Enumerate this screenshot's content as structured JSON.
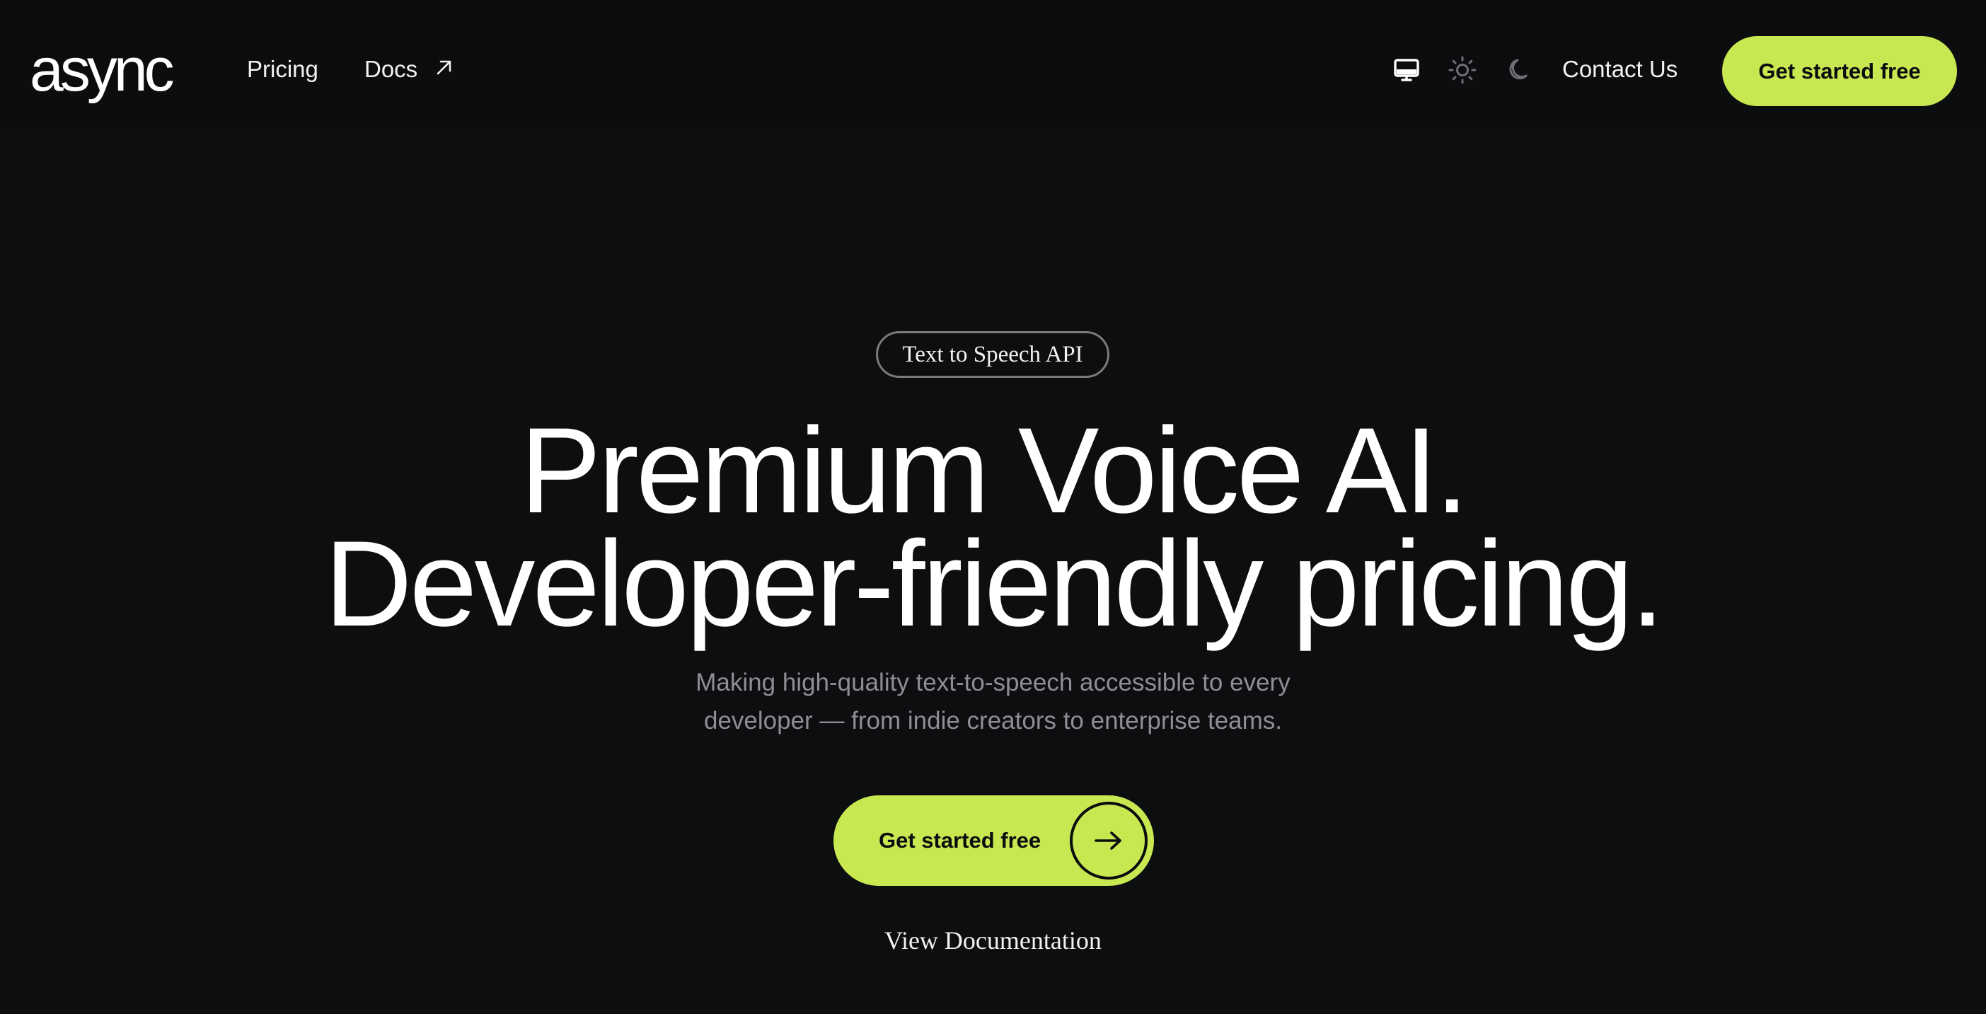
{
  "nav": {
    "logo": "async",
    "links": [
      {
        "label": "Pricing"
      },
      {
        "label": "Docs"
      }
    ],
    "theme_options": [
      "monitor-icon",
      "sun-icon",
      "moon-icon"
    ],
    "contact_label": "Contact Us",
    "cta_label": "Get started free"
  },
  "hero": {
    "badge": "Text to Speech API",
    "headline_line1": "Premium Voice AI.",
    "headline_line2": "Developer-friendly pricing.",
    "subtitle_line1": "Making high-quality text-to-speech accessible to every",
    "subtitle_line2": "developer — from indie creators to enterprise teams.",
    "cta_label": "Get started free",
    "secondary_link": "View Documentation"
  },
  "colors": {
    "background": "#0d0e10",
    "accent": "#c8e851",
    "text": "#ffffff",
    "muted": "#8e8f92"
  }
}
